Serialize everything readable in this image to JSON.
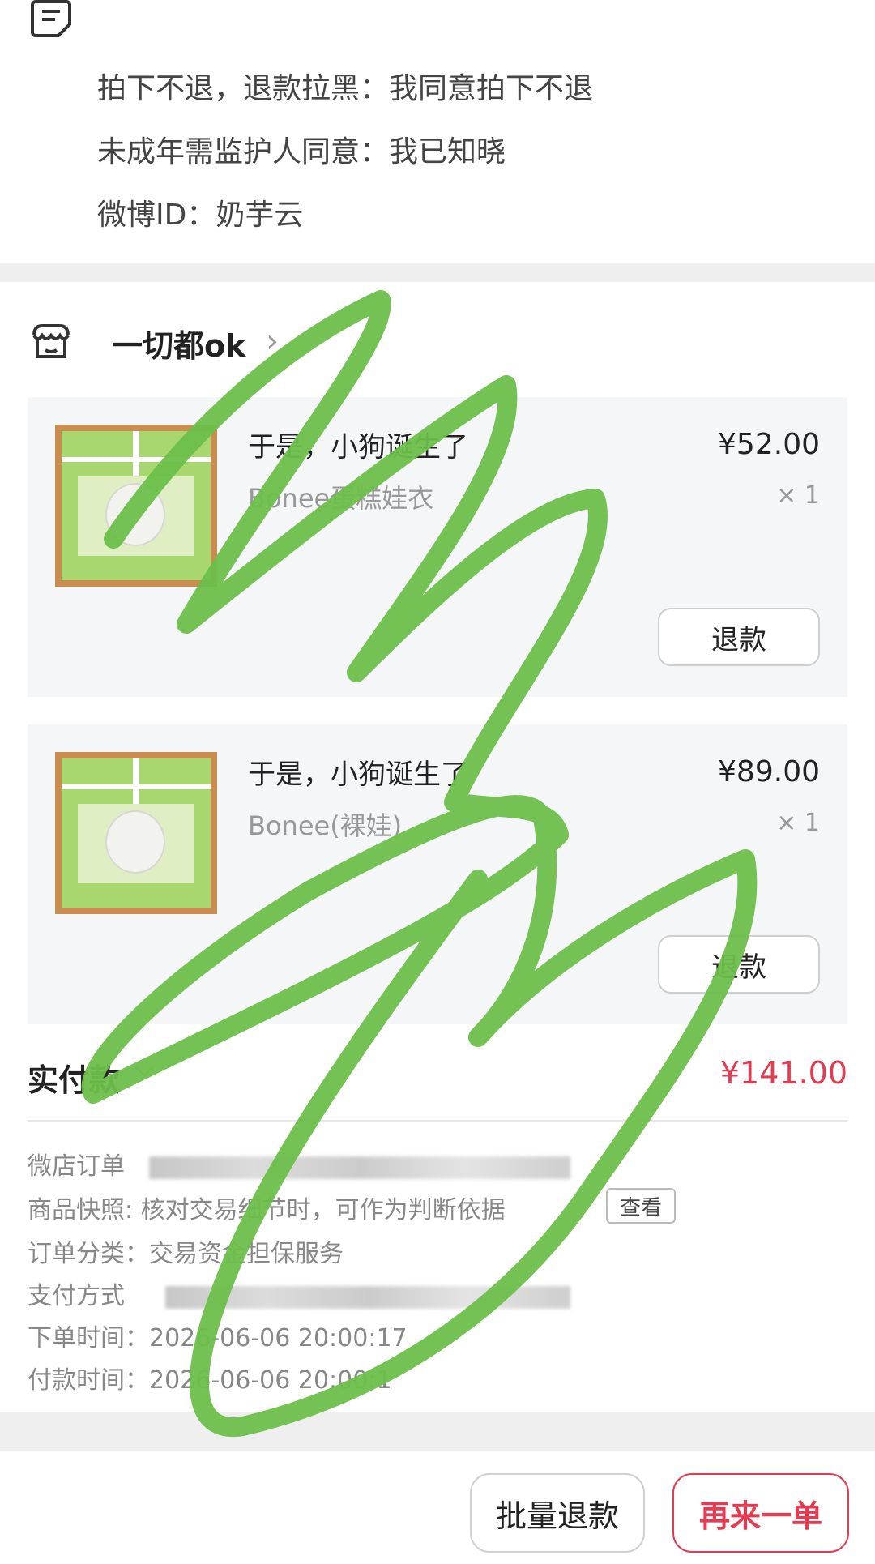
{
  "note": {
    "lines": [
      "拍下不退，退款拉黑：我同意拍下不退",
      "未成年需监护人同意：我已知晓",
      "微博ID：奶芋云"
    ]
  },
  "store": {
    "name": "一切都ok",
    "chevron": "›"
  },
  "items": [
    {
      "title": "于是，小狗诞生了",
      "variant": "Bonee蛋糕娃衣",
      "price": "¥52.00",
      "qty": "× 1",
      "refund_label": "退款"
    },
    {
      "title": "于是，小狗诞生了",
      "variant": "Bonee(裸娃)",
      "price": "¥89.00",
      "qty": "× 1",
      "refund_label": "退款"
    }
  ],
  "payment": {
    "label": "实付款",
    "amount": "¥141.00"
  },
  "order_info": {
    "order_no_label": "微店订单",
    "snapshot_label": "商品快照: 核对交易细节时，可作为判断依据",
    "snapshot_button": "查看",
    "category": "订单分类：交易资金担保服务",
    "pay_method_label": "支付方式",
    "order_time": "下单时间：2026-06-06 20:00:17",
    "pay_time": "付款时间：2026-06-06 20:00:1"
  },
  "bottom": {
    "batch_refund": "批量退款",
    "reorder": "再来一单"
  },
  "colors": {
    "accent": "#e43a52",
    "scribble": "#6bbf4a"
  },
  "icons": [
    "note-icon",
    "store-icon",
    "chevron-right-icon",
    "chevron-down-icon"
  ]
}
